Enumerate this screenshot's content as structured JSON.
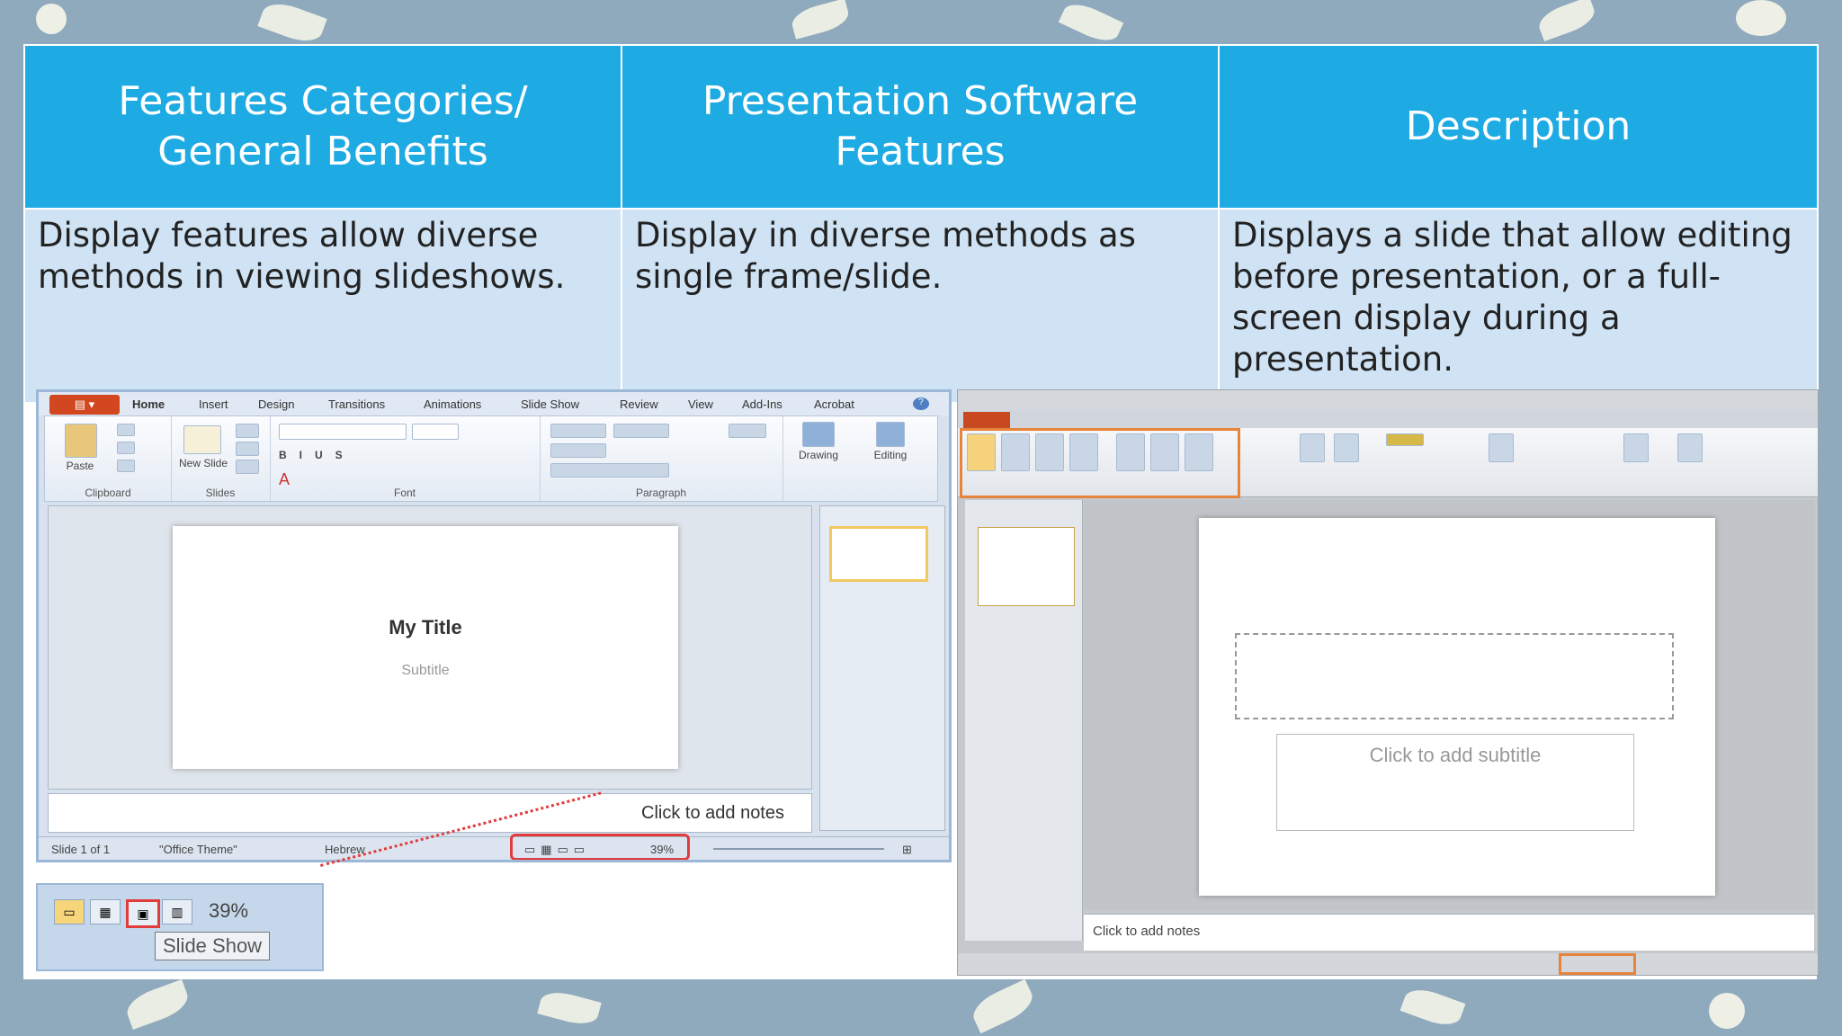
{
  "table": {
    "headers": [
      "Features Categories/ General Benefits",
      "Presentation Software Features",
      "Description"
    ],
    "rows": [
      [
        "Display features allow diverse methods in viewing slideshows.",
        "Display in diverse methods as single frame/slide.",
        "Displays a slide that allow editing before presentation, or a full-screen display during a presentation."
      ]
    ]
  },
  "left_screenshot": {
    "ribbon_tabs": [
      "Home",
      "Insert",
      "Design",
      "Transitions",
      "Animations",
      "Slide Show",
      "Review",
      "View",
      "Add-Ins",
      "Acrobat"
    ],
    "groups": [
      "Clipboard",
      "Slides",
      "Font",
      "Paragraph"
    ],
    "buttons": {
      "paste": "Paste",
      "new_slide": "New Slide",
      "drawing": "Drawing",
      "editing": "Editing"
    },
    "slide_title": "My Title",
    "slide_subtitle": "Subtitle",
    "notes_placeholder": "Click to add notes",
    "status": {
      "slide": "Slide 1 of 1",
      "theme": "\"Office Theme\"",
      "language": "Hebrew",
      "zoom": "39%"
    }
  },
  "zoom_inset": {
    "zoom": "39%",
    "tooltip": "Slide Show"
  },
  "right_screenshot": {
    "subtitle_placeholder": "Click to add subtitle",
    "notes_placeholder": "Click to add notes"
  },
  "colors": {
    "header_blue": "#1eaae3",
    "cell_blue": "#cfe3f5",
    "highlight_red": "#e23b3b",
    "highlight_orange": "#e8833a"
  }
}
